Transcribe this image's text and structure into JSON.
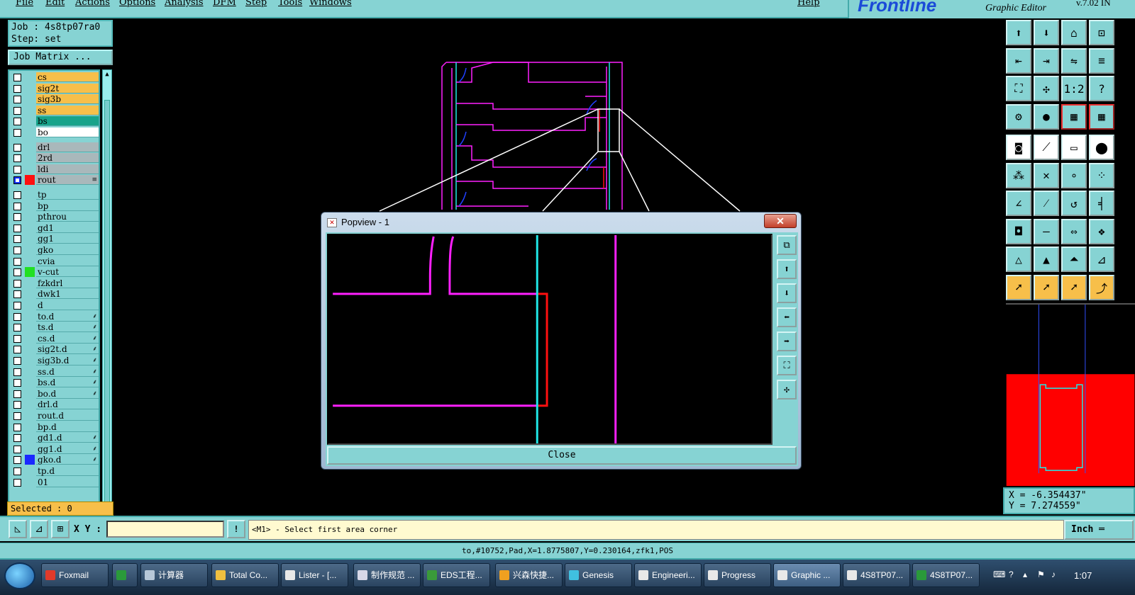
{
  "menu": {
    "items": [
      "File",
      "Edit",
      "Actions",
      "Options",
      "Analysis",
      "DFM",
      "Step",
      "Tools",
      "Windows"
    ],
    "help": "Help"
  },
  "brand": {
    "logo": "Frontline",
    "subtitle": "Graphic Editor",
    "version": "v.7.02 IN"
  },
  "job": {
    "job_label": "Job : 4s8tp07ra0",
    "step_label": "Step: set",
    "matrix_button": "Job Matrix ..."
  },
  "layers": [
    {
      "name": "cs",
      "color": "#f7bf4a",
      "swatch": "",
      "checked": false,
      "mark": ""
    },
    {
      "name": "sig2t",
      "color": "#f7bf4a",
      "swatch": "",
      "checked": false,
      "mark": ""
    },
    {
      "name": "sig3b",
      "color": "#f7bf4a",
      "swatch": "",
      "checked": false,
      "mark": ""
    },
    {
      "name": "ss",
      "color": "#f7bf4a",
      "swatch": "",
      "checked": false,
      "mark": ""
    },
    {
      "name": "bs",
      "color": "#17a38a",
      "swatch": "",
      "checked": false,
      "mark": ""
    },
    {
      "name": "bo",
      "color": "#ffffff",
      "swatch": "",
      "checked": false,
      "mark": ""
    },
    {
      "name": "drl",
      "color": "#a9b8bb",
      "swatch": "",
      "checked": false,
      "mark": ""
    },
    {
      "name": "2rd",
      "color": "#a9b8bb",
      "swatch": "",
      "checked": false,
      "mark": ""
    },
    {
      "name": "ldi",
      "color": "#a9b8bb",
      "swatch": "",
      "checked": false,
      "mark": ""
    },
    {
      "name": "rout",
      "color": "#a9b8bb",
      "swatch": "#ff1010",
      "checked": true,
      "mark": "≡"
    },
    {
      "name": "tp",
      "color": "#86d3d3",
      "swatch": "",
      "checked": false,
      "mark": ""
    },
    {
      "name": "bp",
      "color": "#86d3d3",
      "swatch": "",
      "checked": false,
      "mark": ""
    },
    {
      "name": "pthrou",
      "color": "#86d3d3",
      "swatch": "",
      "checked": false,
      "mark": ""
    },
    {
      "name": "gd1",
      "color": "#86d3d3",
      "swatch": "",
      "checked": false,
      "mark": ""
    },
    {
      "name": "gg1",
      "color": "#86d3d3",
      "swatch": "",
      "checked": false,
      "mark": ""
    },
    {
      "name": "gko",
      "color": "#86d3d3",
      "swatch": "",
      "checked": false,
      "mark": ""
    },
    {
      "name": "cvia",
      "color": "#86d3d3",
      "swatch": "",
      "checked": false,
      "mark": ""
    },
    {
      "name": "v-cut",
      "color": "#86d3d3",
      "swatch": "#22e022",
      "checked": false,
      "mark": ""
    },
    {
      "name": "fzkdrl",
      "color": "#86d3d3",
      "swatch": "",
      "checked": false,
      "mark": ""
    },
    {
      "name": "dwk1",
      "color": "#86d3d3",
      "swatch": "",
      "checked": false,
      "mark": ""
    },
    {
      "name": "d",
      "color": "#86d3d3",
      "swatch": "",
      "checked": false,
      "mark": ""
    },
    {
      "name": "to.d",
      "color": "#86d3d3",
      "swatch": "",
      "checked": false,
      "mark": "⸙"
    },
    {
      "name": "ts.d",
      "color": "#86d3d3",
      "swatch": "",
      "checked": false,
      "mark": "⸙"
    },
    {
      "name": "cs.d",
      "color": "#86d3d3",
      "swatch": "",
      "checked": false,
      "mark": "⸙"
    },
    {
      "name": "sig2t.d",
      "color": "#86d3d3",
      "swatch": "",
      "checked": false,
      "mark": "⸙"
    },
    {
      "name": "sig3b.d",
      "color": "#86d3d3",
      "swatch": "",
      "checked": false,
      "mark": "⸙"
    },
    {
      "name": "ss.d",
      "color": "#86d3d3",
      "swatch": "",
      "checked": false,
      "mark": "⸙"
    },
    {
      "name": "bs.d",
      "color": "#86d3d3",
      "swatch": "",
      "checked": false,
      "mark": "⸙"
    },
    {
      "name": "bo.d",
      "color": "#86d3d3",
      "swatch": "",
      "checked": false,
      "mark": "⸙"
    },
    {
      "name": "drl.d",
      "color": "#86d3d3",
      "swatch": "",
      "checked": false,
      "mark": ""
    },
    {
      "name": "rout.d",
      "color": "#86d3d3",
      "swatch": "",
      "checked": false,
      "mark": ""
    },
    {
      "name": "bp.d",
      "color": "#86d3d3",
      "swatch": "",
      "checked": false,
      "mark": ""
    },
    {
      "name": "gd1.d",
      "color": "#86d3d3",
      "swatch": "",
      "checked": false,
      "mark": "⸙"
    },
    {
      "name": "gg1.d",
      "color": "#86d3d3",
      "swatch": "",
      "checked": false,
      "mark": "⸙"
    },
    {
      "name": "gko.d",
      "color": "#86d3d3",
      "swatch": "#1a28ff",
      "checked": false,
      "mark": "⸙"
    },
    {
      "name": "tp.d",
      "color": "#86d3d3",
      "swatch": "",
      "checked": false,
      "mark": ""
    },
    {
      "name": "01",
      "color": "#86d3d3",
      "swatch": "",
      "checked": false,
      "mark": ""
    }
  ],
  "selected_label": "Selected : 0",
  "coords": {
    "x": "X = -6.354437\"",
    "y": "Y = 7.274559\""
  },
  "input": {
    "xy_label": "X Y :",
    "xy_value": "",
    "excl": "!",
    "prompt": "<M1> - Select first area corner",
    "units": "Inch ═"
  },
  "status_text": "to,#10752,Pad,X=1.8775807,Y=0.230164,zfk1,POS",
  "popview": {
    "title": "Popview - 1",
    "close_x": "✕",
    "close_button": "Close"
  },
  "taskbar": {
    "tasks": [
      {
        "label": "Foxmail",
        "color": "#e03a2a"
      },
      {
        "label": "",
        "color": "#2a9a3a"
      },
      {
        "label": "计算器",
        "color": "#b8c8d8"
      },
      {
        "label": "Total Co...",
        "color": "#f0c040"
      },
      {
        "label": "Lister - [...",
        "color": "#e8e8e8"
      },
      {
        "label": "制作规范 ...",
        "color": "#d8d8e8"
      },
      {
        "label": "EDS工程...",
        "color": "#3a9a3a"
      },
      {
        "label": "兴森快捷...",
        "color": "#f0a020"
      },
      {
        "label": "Genesis",
        "color": "#40c0e0"
      },
      {
        "label": "Engineeri...",
        "color": "#e8e8e8"
      },
      {
        "label": "Progress",
        "color": "#e8e8e8"
      },
      {
        "label": "Graphic ...",
        "color": "#e8e8e8"
      },
      {
        "label": "4S8TP07...",
        "color": "#e8e8e8"
      },
      {
        "label": "4S8TP07...",
        "color": "#2a9a3a"
      }
    ],
    "clock": "1:07"
  },
  "colors": {
    "panel": "#86d3d3",
    "magenta": "#ff20ff",
    "cyan": "#20e8e8",
    "red": "#ff1010",
    "canvas_bg": "#000000"
  }
}
